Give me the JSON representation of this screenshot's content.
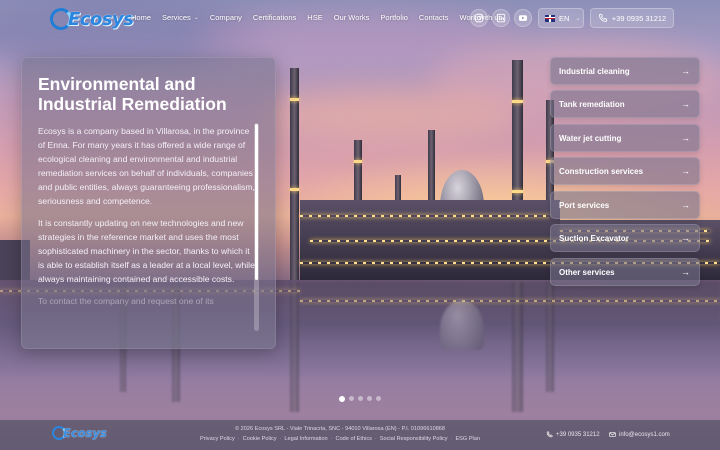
{
  "header": {
    "logo_text": "Ecosys",
    "nav": [
      {
        "label": "Home",
        "dropdown": false
      },
      {
        "label": "Services",
        "dropdown": true
      },
      {
        "label": "Company",
        "dropdown": false
      },
      {
        "label": "Certifications",
        "dropdown": false
      },
      {
        "label": "HSE",
        "dropdown": false
      },
      {
        "label": "Our Works",
        "dropdown": false
      },
      {
        "label": "Portfolio",
        "dropdown": false
      },
      {
        "label": "Contacts",
        "dropdown": false
      },
      {
        "label": "Work with us",
        "dropdown": false
      }
    ],
    "social": [
      "instagram-icon",
      "linkedin-icon",
      "youtube-icon"
    ],
    "language": "EN",
    "phone": "+39 0935 31212"
  },
  "hero": {
    "title": "Environmental and Industrial Remediation",
    "paragraphs": [
      "Ecosys is a company based in Villarosa, in the province of Enna. For many years it has offered a wide range of ecological cleaning and environmental and industrial remediation services on behalf of individuals, companies and public entities, always guaranteeing professionalism, seriousness and competence.",
      "It is constantly updating on new technologies and new strategies in the reference market and uses the most sophisticated machinery in the sector, thanks to which it is able to establish itself as a leader at a local level, while always maintaining contained and accessible costs.",
      "To contact the company and request one of its"
    ]
  },
  "services": [
    "Industrial cleaning",
    "Tank remediation",
    "Water jet cutting",
    "Construction services",
    "Port services",
    "Suction Excavator",
    "Other services"
  ],
  "carousel": {
    "total": 5,
    "active": 1
  },
  "footer": {
    "logo_text": "Ecosys",
    "copyright": "© 2026 Ecosys SRL - Viale Trinacria, SNC - 94010 Villarosa (EN) - P.I. 01096610868",
    "links": [
      "Privacy Policy",
      "Cookie Policy",
      "Legal Information",
      "Code of Ethics",
      "Social Responsibility Policy",
      "ESG Plan"
    ],
    "phone": "+39 0935 31212",
    "email": "info@ecosys1.com"
  },
  "colors": {
    "brand": "#2b86e0",
    "panel": "#78738c",
    "text": "#ffffff"
  }
}
